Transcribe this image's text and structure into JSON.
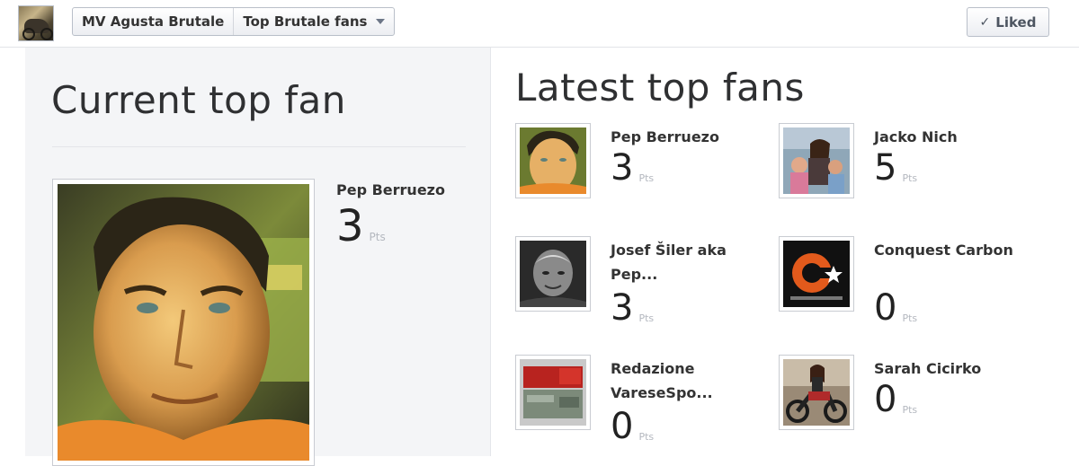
{
  "header": {
    "page_name": "MV Agusta Brutale",
    "app_name": "Top Brutale fans",
    "liked_label": "Liked",
    "check_glyph": "✓"
  },
  "current": {
    "title": "Current top fan",
    "fan": {
      "name": "Pep Berruezo",
      "points": "3",
      "pts_label": "Pts"
    }
  },
  "latest": {
    "title": "Latest top fans",
    "fans": [
      {
        "name": "Pep Berruezo",
        "points": "3",
        "pts_label": "Pts",
        "avatar": "man-portrait"
      },
      {
        "name": "Jacko Nich",
        "points": "5",
        "pts_label": "Pts",
        "avatar": "family-photo"
      },
      {
        "name": "Josef Šiler aka Pep...",
        "points": "3",
        "pts_label": "Pts",
        "avatar": "bw-portrait"
      },
      {
        "name": "Conquest Carbon",
        "points": "0",
        "pts_label": "Pts",
        "avatar": "conquest-logo"
      },
      {
        "name": "Redazione VareseSpo...",
        "points": "0",
        "pts_label": "Pts",
        "avatar": "tv-logo"
      },
      {
        "name": "Sarah Cicirko",
        "points": "0",
        "pts_label": "Pts",
        "avatar": "motorbike-photo"
      }
    ]
  },
  "colors": {
    "panel_bg": "#f4f5f7",
    "text": "#333333",
    "pts_grey": "#b4b8bf",
    "border": "#b9bfc9"
  }
}
